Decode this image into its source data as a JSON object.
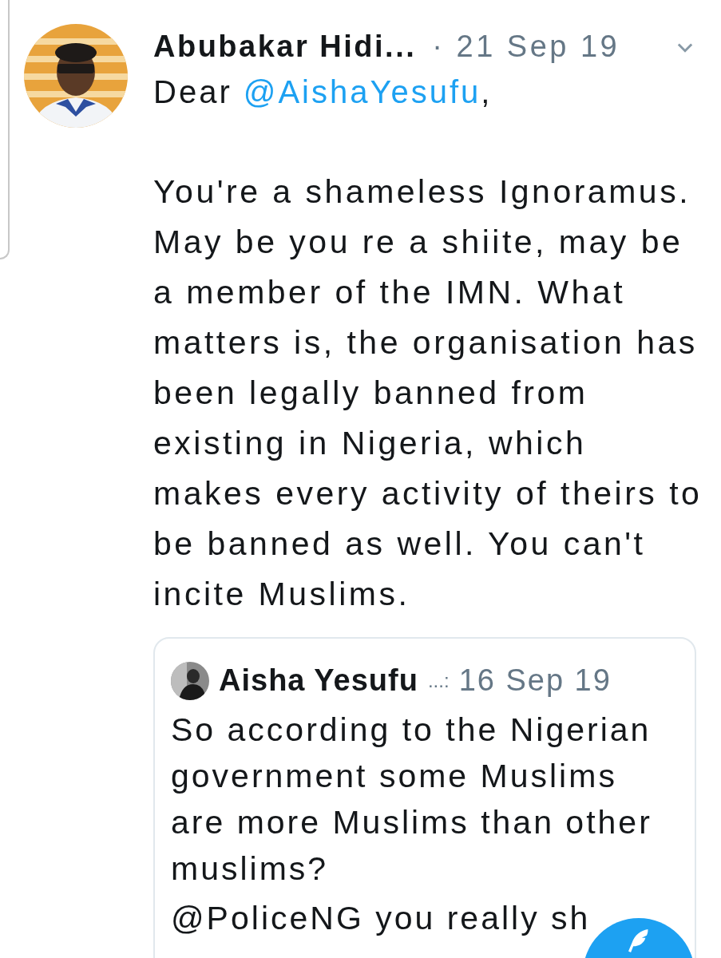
{
  "tweet": {
    "author": "Abubakar Hidi...",
    "date": "· 21 Sep 19",
    "greeting_prefix": "Dear ",
    "mention": "@AishaYesufu",
    "greeting_suffix": ",",
    "body": "You're a shameless Ignoramus. May be you re a shiite, may be a member of the IMN. What matters is, the organisation has been legally banned from existing in Nigeria, which makes every activity of theirs to be banned as well. You can't incite Muslims."
  },
  "quoted_tweet": {
    "author": "Aisha Yesufu",
    "separator": "...:",
    "date": "16 Sep 19",
    "body": [
      "So according to the Nigerian government some Muslims are more Muslims than other muslims?",
      "@PoliceNG you really sh"
    ]
  }
}
